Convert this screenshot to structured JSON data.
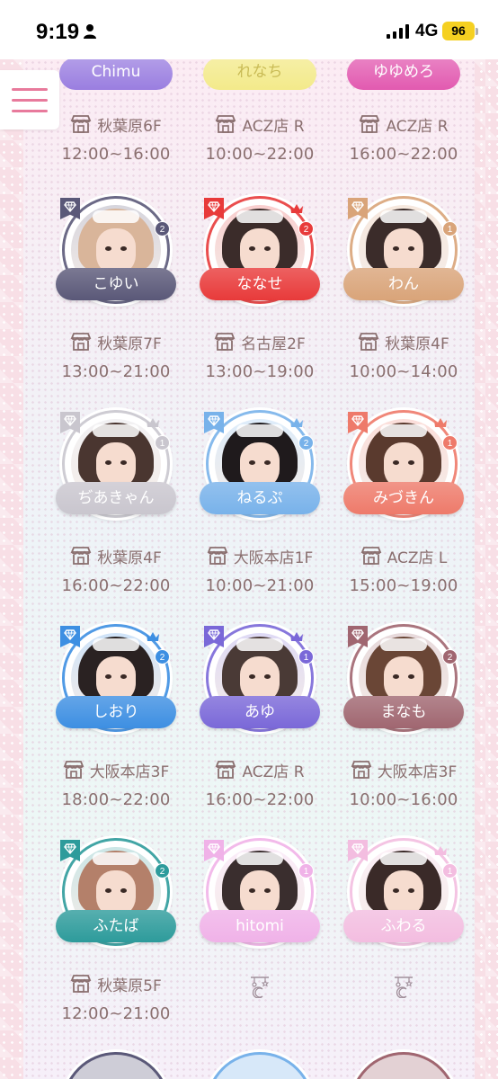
{
  "status_bar": {
    "time": "9:19",
    "network": "4G",
    "battery": "96"
  },
  "colors": {
    "purple": "#9a7ee0",
    "yellow": "#f3ea8a",
    "magenta": "#e25ab0",
    "navy": "#5a5878",
    "red": "#e83a3a",
    "tan": "#d9a479",
    "silver": "#c9c6ce",
    "skyblue": "#78b2ea",
    "coral": "#ee7a6a",
    "blue": "#3d8fe2",
    "violet": "#7a68d8",
    "mauve": "#a06670",
    "teal": "#2d9b9b",
    "pink": "#f0b2e8",
    "lightpink": "#f3bde0",
    "text": "#8a6f6f"
  },
  "top_row": [
    {
      "name": "Chimu",
      "location": "秋葉原6F",
      "hours": "12:00~16:00",
      "color": "purple"
    },
    {
      "name": "れなち",
      "location": "ACZ店 R",
      "hours": "10:00~22:00",
      "color": "yellow"
    },
    {
      "name": "ゆゆめろ",
      "location": "ACZ店 R",
      "hours": "16:00~22:00",
      "color": "magenta"
    }
  ],
  "cast": [
    {
      "name": "こゆい",
      "rank": "2",
      "location": "秋葉原7F",
      "hours": "13:00~21:00",
      "color": "navy",
      "badge": "diamond",
      "crown": false,
      "hair": "#d9b59a"
    },
    {
      "name": "ななせ",
      "rank": "2",
      "location": "名古屋2F",
      "hours": "13:00~19:00",
      "color": "red",
      "badge": "diamond",
      "crown": true,
      "hair": "#3b2c2a"
    },
    {
      "name": "わん",
      "rank": "1",
      "location": "秋葉原4F",
      "hours": "10:00~14:00",
      "color": "tan",
      "badge": "diamond",
      "crown": false,
      "hair": "#3b2c2a"
    },
    {
      "name": "ぢあきゃん",
      "rank": "1",
      "location": "秋葉原4F",
      "hours": "16:00~22:00",
      "color": "silver",
      "badge": "diamond",
      "crown": true,
      "hair": "#4a3630"
    },
    {
      "name": "ねるぷ",
      "rank": "2",
      "location": "大阪本店1F",
      "hours": "10:00~21:00",
      "color": "skyblue",
      "badge": "diamond",
      "crown": true,
      "hair": "#1f1a1c"
    },
    {
      "name": "みづきん",
      "rank": "1",
      "location": "ACZ店 L",
      "hours": "15:00~19:00",
      "color": "coral",
      "badge": "diamond",
      "crown": true,
      "hair": "#5a3a2e"
    },
    {
      "name": "しおり",
      "rank": "2",
      "location": "大阪本店3F",
      "hours": "18:00~22:00",
      "color": "blue",
      "badge": "diamond",
      "crown": true,
      "hair": "#2a2222"
    },
    {
      "name": "あゆ",
      "rank": "1",
      "location": "ACZ店 R",
      "hours": "16:00~22:00",
      "color": "violet",
      "badge": "diamond",
      "crown": true,
      "hair": "#4a3a36"
    },
    {
      "name": "まなも",
      "rank": "2",
      "location": "大阪本店3F",
      "hours": "10:00~16:00",
      "color": "mauve",
      "badge": "diamond",
      "crown": false,
      "hair": "#6a4636"
    },
    {
      "name": "ふたば",
      "rank": "2",
      "location": "秋葉原5F",
      "hours": "12:00~21:00",
      "color": "teal",
      "badge": "diamond",
      "crown": false,
      "hair": "#b4806a"
    },
    {
      "name": "hitomi",
      "rank": "1",
      "location": "",
      "hours": "",
      "color": "pink",
      "badge": "diamond",
      "crown": false,
      "hair": "#3a2e2e"
    },
    {
      "name": "ふわる",
      "rank": "1",
      "location": "",
      "hours": "",
      "color": "lightpink",
      "badge": "diamond",
      "crown": true,
      "hair": "#3a2a28"
    }
  ],
  "bottom_peek": [
    {
      "color": "navy"
    },
    {
      "color": "skyblue"
    },
    {
      "color": "mauve"
    }
  ]
}
